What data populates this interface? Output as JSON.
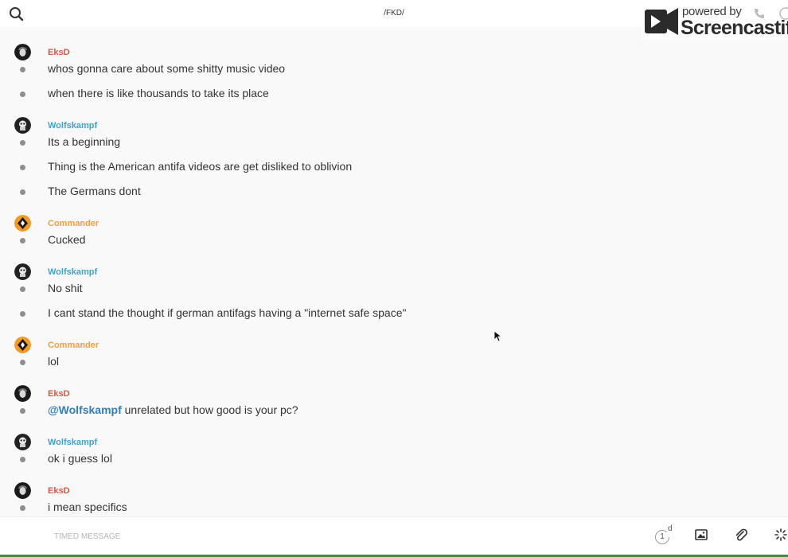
{
  "header": {
    "channel_title": "/FKD/",
    "search_icon": "search-icon"
  },
  "watermark": {
    "small": "powered by",
    "big": "Screencastify"
  },
  "colors": {
    "EksD": "#d35a48",
    "Wolfskampf": "#3fa3cf",
    "Commander": "#f0a040",
    "mention": "#2f7fb8"
  },
  "messages": [
    {
      "author": "EksD",
      "lines": [
        "whos gonna care about some shitty music video",
        "when there is like thousands to take its place"
      ]
    },
    {
      "author": "Wolfskampf",
      "lines": [
        "Its a beginning",
        "Thing is the American antifa videos are get disliked to oblivion",
        "The Germans dont"
      ]
    },
    {
      "author": "Commander",
      "lines": [
        "Cucked"
      ]
    },
    {
      "author": "Wolfskampf",
      "lines": [
        "No shit",
        "I cant stand the thought if german antifags having a \"internet safe space\""
      ]
    },
    {
      "author": "Commander",
      "lines": [
        "lol"
      ]
    },
    {
      "author": "EksD",
      "mention": "@Wolfskampf",
      "lines": [
        " unrelated but how good is your pc?"
      ]
    },
    {
      "author": "Wolfskampf",
      "lines": [
        "ok i guess lol"
      ]
    },
    {
      "author": "EksD",
      "lines": [
        "i mean specifics"
      ]
    }
  ],
  "composer": {
    "placeholder": "TIMED MESSAGE",
    "timer_value": "1",
    "timer_unit": "d",
    "icons": [
      "timer-icon",
      "image-icon",
      "paperclip-icon",
      "loading-icon"
    ]
  }
}
